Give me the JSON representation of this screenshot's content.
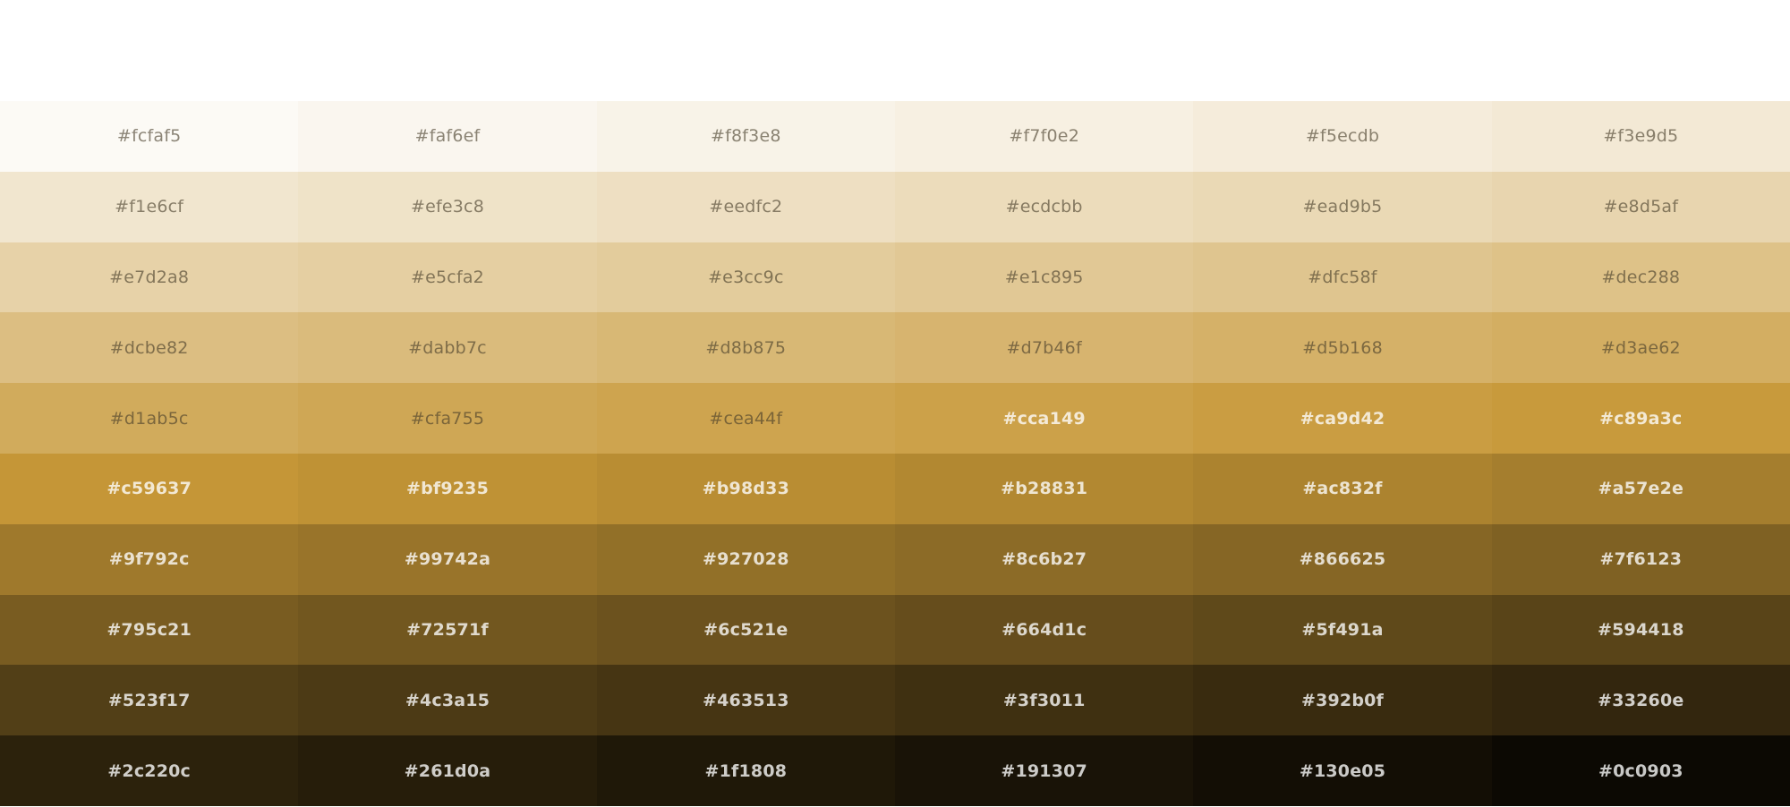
{
  "palette": {
    "swatches": [
      "#fcfaf5",
      "#faf6ef",
      "#f8f3e8",
      "#f7f0e2",
      "#f5ecdb",
      "#f3e9d5",
      "#f1e6cf",
      "#efe3c8",
      "#eedfc2",
      "#ecdcbb",
      "#ead9b5",
      "#e8d5af",
      "#e7d2a8",
      "#e5cfa2",
      "#e3cc9c",
      "#e1c895",
      "#dfc58f",
      "#dec288",
      "#dcbe82",
      "#dabb7c",
      "#d8b875",
      "#d7b46f",
      "#d5b168",
      "#d3ae62",
      "#d1ab5c",
      "#cfa755",
      "#cea44f",
      "#cca149",
      "#ca9d42",
      "#c89a3c",
      "#c59637",
      "#bf9235",
      "#b98d33",
      "#b28831",
      "#ac832f",
      "#a57e2e",
      "#9f792c",
      "#99742a",
      "#927028",
      "#8c6b27",
      "#866625",
      "#7f6123",
      "#795c21",
      "#72571f",
      "#6c521e",
      "#664d1c",
      "#5f491a",
      "#594418",
      "#523f17",
      "#4c3a15",
      "#463513",
      "#3f3011",
      "#392b0f",
      "#33260e",
      "#2c220c",
      "#261d0a",
      "#1f1808",
      "#191307",
      "#130e05",
      "#0c0903"
    ]
  }
}
